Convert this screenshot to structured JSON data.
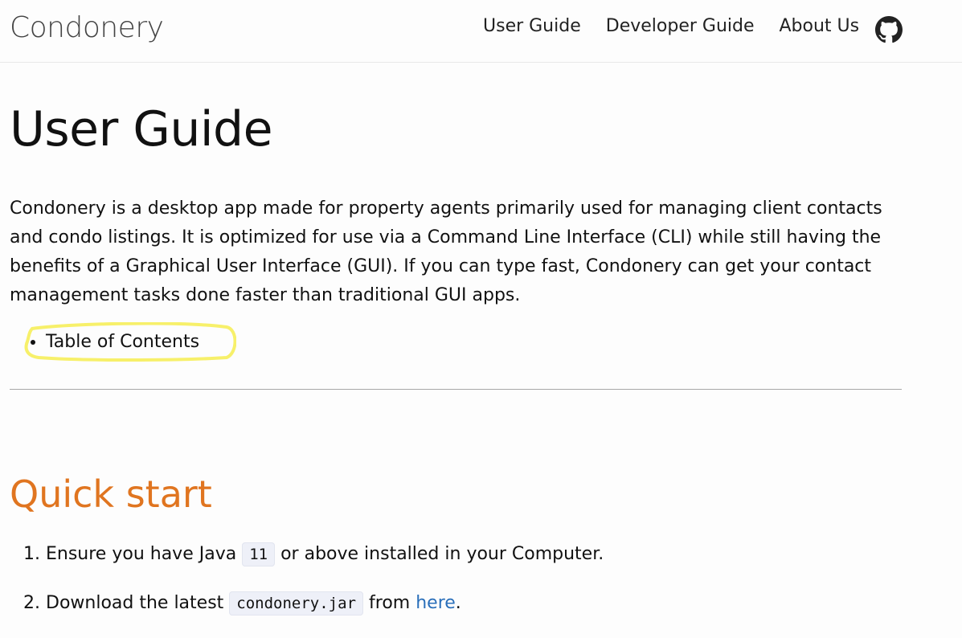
{
  "header": {
    "brand": "Condonery",
    "nav": [
      {
        "label": "User Guide"
      },
      {
        "label": "Developer Guide"
      },
      {
        "label": "About Us"
      }
    ],
    "github_icon": "github-icon"
  },
  "main": {
    "title": "User Guide",
    "intro": "Condonery is a desktop app made for property agents primarily used for managing client contacts and condo listings. It is optimized for use via a Command Line Interface (CLI) while still having the benefits of a Graphical User Interface (GUI). If you can type fast, Condonery can get your contact management tasks done faster than traditional GUI apps.",
    "toc_item": "Table of Contents",
    "quick_start": {
      "title": "Quick start",
      "steps": [
        {
          "before": "Ensure you have Java",
          "code": "11",
          "after": "or above installed in your Computer."
        },
        {
          "before": "Download the latest",
          "code": "condonery.jar",
          "middle": "from",
          "link": "here",
          "after": "."
        }
      ]
    }
  },
  "colors": {
    "heading_accent": "#e07520",
    "link": "#2a6fba",
    "highlight": "#f7f06a"
  }
}
